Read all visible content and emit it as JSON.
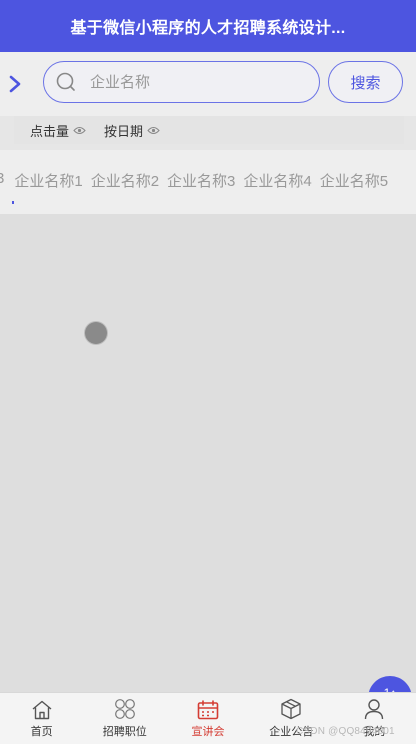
{
  "header": {
    "title": "基于微信小程序的人才招聘系统设计..."
  },
  "search": {
    "placeholder": "企业名称",
    "button_label": "搜索"
  },
  "sort": [
    {
      "label": "点击量",
      "icon": "eye-icon"
    },
    {
      "label": "按日期",
      "icon": "eye-icon"
    }
  ],
  "categories": {
    "partial": "3",
    "items": [
      "企业名称1",
      "企业名称2",
      "企业名称3",
      "企业名称4",
      "企业名称5"
    ]
  },
  "fab": {
    "label": "1↑"
  },
  "tabbar": [
    {
      "label": "首页",
      "icon": "home-icon",
      "active": false
    },
    {
      "label": "招聘职位",
      "icon": "grid-icon",
      "active": false
    },
    {
      "label": "宣讲会",
      "icon": "calendar-icon",
      "active": true
    },
    {
      "label": "企业公告",
      "icon": "box-icon",
      "active": false
    },
    {
      "label": "我的",
      "icon": "user-icon",
      "active": false
    }
  ],
  "watermark": "CSDN @QQ8494001",
  "colors": {
    "primary": "#4d55e0",
    "active_tab": "#d43c33"
  }
}
